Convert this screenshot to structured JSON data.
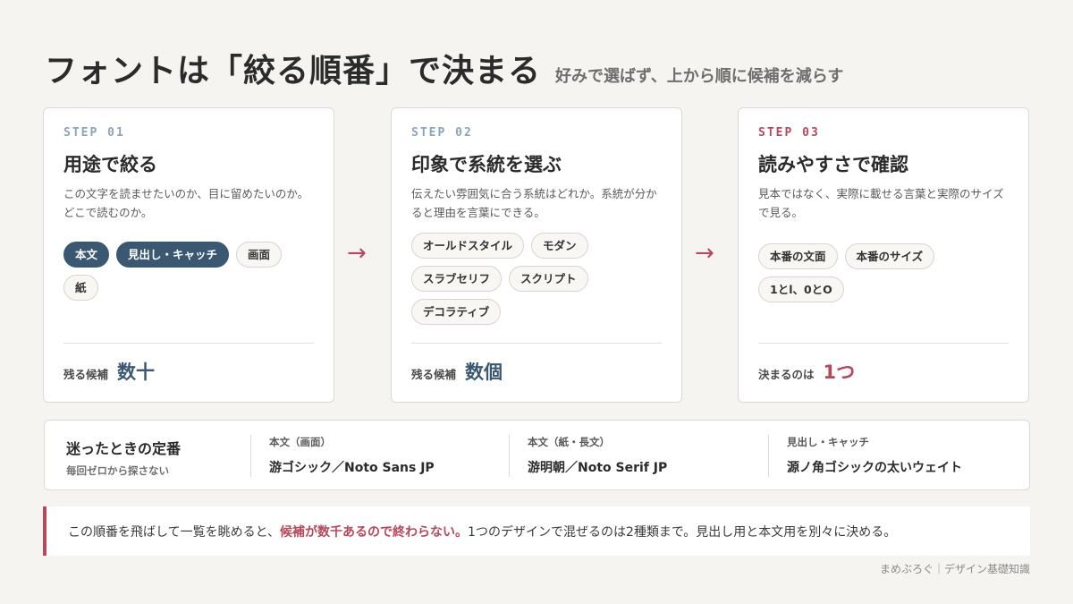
{
  "header": {
    "title": "フォントは「絞る順番」で決まる",
    "subtitle": "好みで選ばず、上から順に候補を減らす"
  },
  "steps": [
    {
      "label": "STEP 01",
      "title": "用途で絞る",
      "desc": "この文字を読ませたいのか、目に留めたいのか。どこで読むのか。",
      "tags": [
        "本文",
        "見出し・キャッチ",
        "画面",
        "紙"
      ],
      "active_tags": [
        "本文",
        "見出し・キャッチ"
      ],
      "foot_label": "残る候補",
      "foot_value": "数十"
    },
    {
      "label": "STEP 02",
      "title": "印象で系統を選ぶ",
      "desc": "伝えたい雰囲気に合う系統はどれか。系統が分かると理由を言葉にできる。",
      "tags": [
        "オールドスタイル",
        "モダン",
        "スラブセリフ",
        "スクリプト",
        "デコラティブ"
      ],
      "foot_label": "残る候補",
      "foot_value": "数個"
    },
    {
      "label": "STEP 03",
      "title": "読みやすさで確認",
      "desc": "見本ではなく、実際に載せる言葉と実際のサイズで見る。",
      "tags": [
        "本番の文面",
        "本番のサイズ",
        "1とl、0とO"
      ],
      "foot_label": "決まるのは",
      "foot_value": "1つ"
    }
  ],
  "arrows": [
    "→",
    "→"
  ],
  "defaults": {
    "title": "迷ったときの定番",
    "sub": "毎回ゼロから探さない",
    "columns": [
      {
        "label": "本文（画面）",
        "value": "游ゴシック／Noto Sans JP"
      },
      {
        "label": "本文（紙・長文）",
        "value": "游明朝／Noto Serif JP"
      },
      {
        "label": "見出し・キャッチ",
        "value": "源ノ角ゴシックの太いウェイト"
      }
    ]
  },
  "note": {
    "before": "この順番を飛ばして一覧を眺めると、",
    "highlight": "候補が数千あるので終わらない。",
    "after": "1つのデザインで混ぜるのは2種類まで。見出し用と本文用を別々に決める。"
  },
  "footer": "まめぶろぐ｜デザイン基礎知識",
  "colors": {
    "accent": "#b5485a",
    "navy": "#3b5873",
    "step_label": "#8aa4bd",
    "background": "#f5f4f1"
  }
}
